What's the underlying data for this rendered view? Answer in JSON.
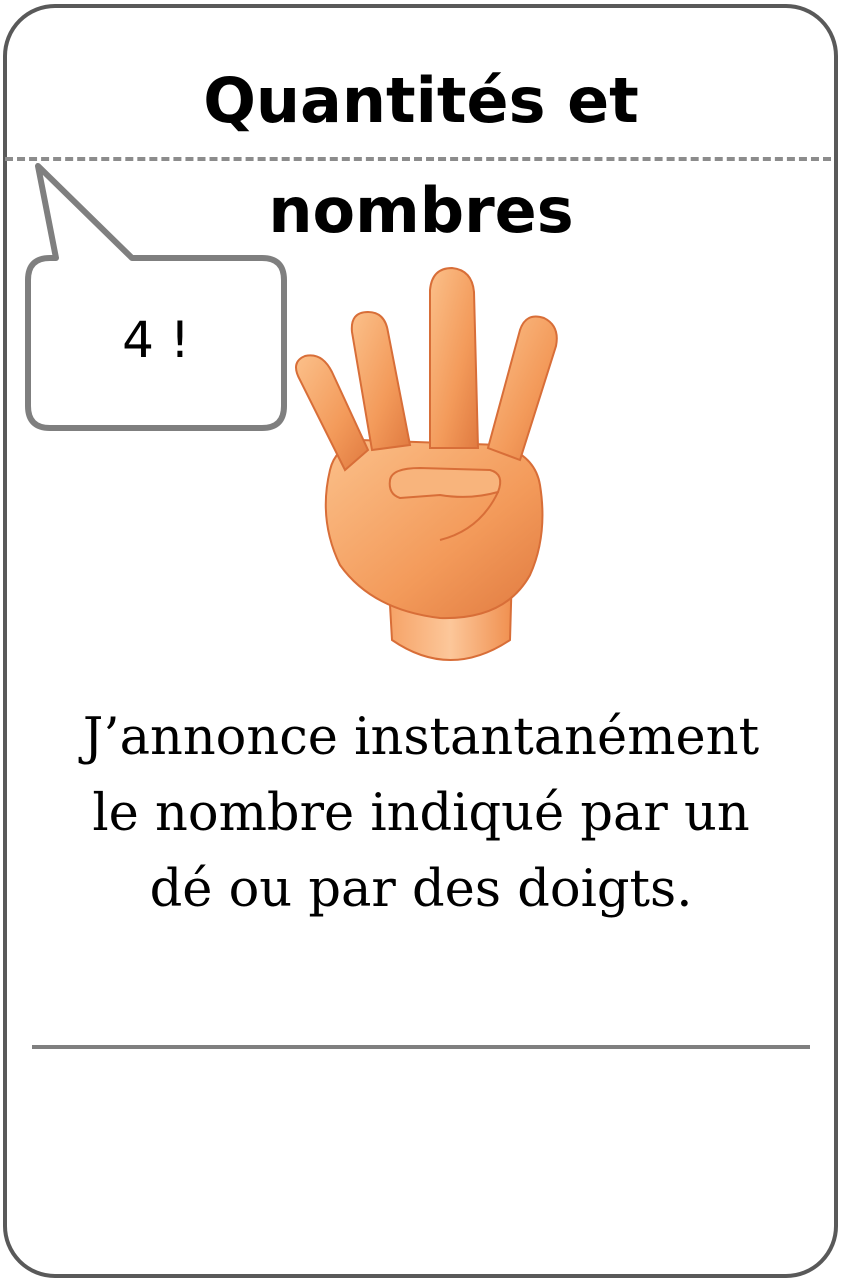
{
  "card": {
    "title_line1": "Quantités et",
    "title_line2": "nombres",
    "bubble_text": "4 !",
    "description": "J’annonce instantanément le nombre indiqué par un dé ou par des doigts."
  },
  "icons": {
    "hand": "hand-four-fingers-icon"
  },
  "colors": {
    "border": "#595959",
    "dashed": "#8c8c8c",
    "skin": "#f39a5a"
  }
}
